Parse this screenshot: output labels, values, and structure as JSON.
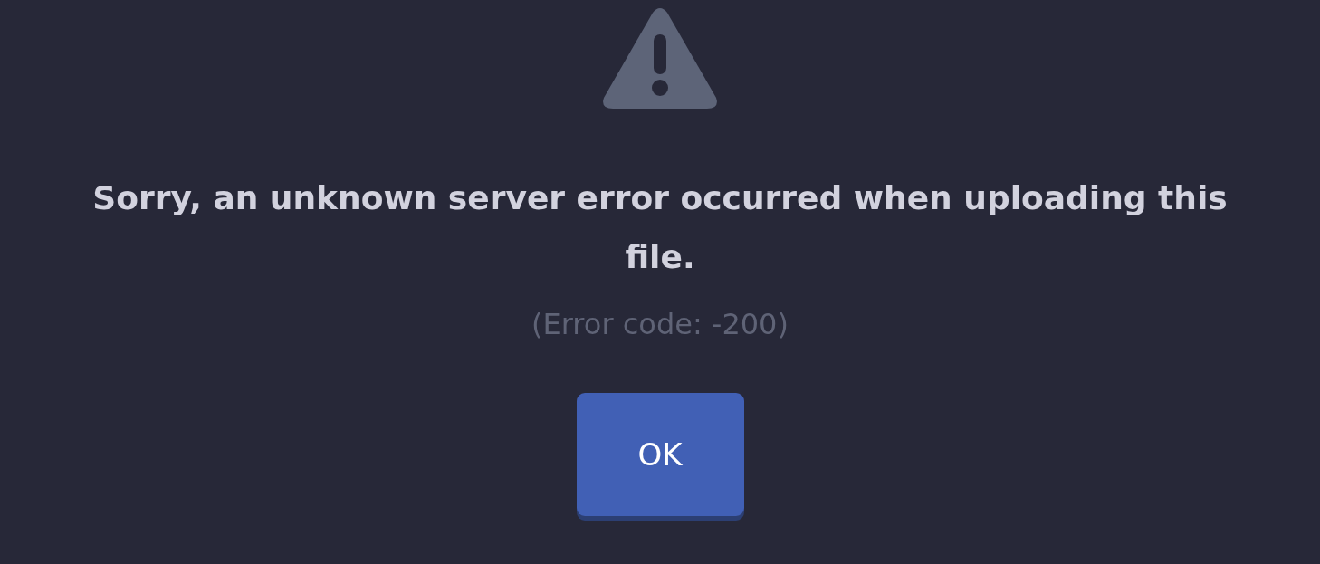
{
  "dialog": {
    "message": "Sorry, an unknown server error occurred when uploading this file.",
    "detail": "(Error code: -200)",
    "button": "OK"
  }
}
